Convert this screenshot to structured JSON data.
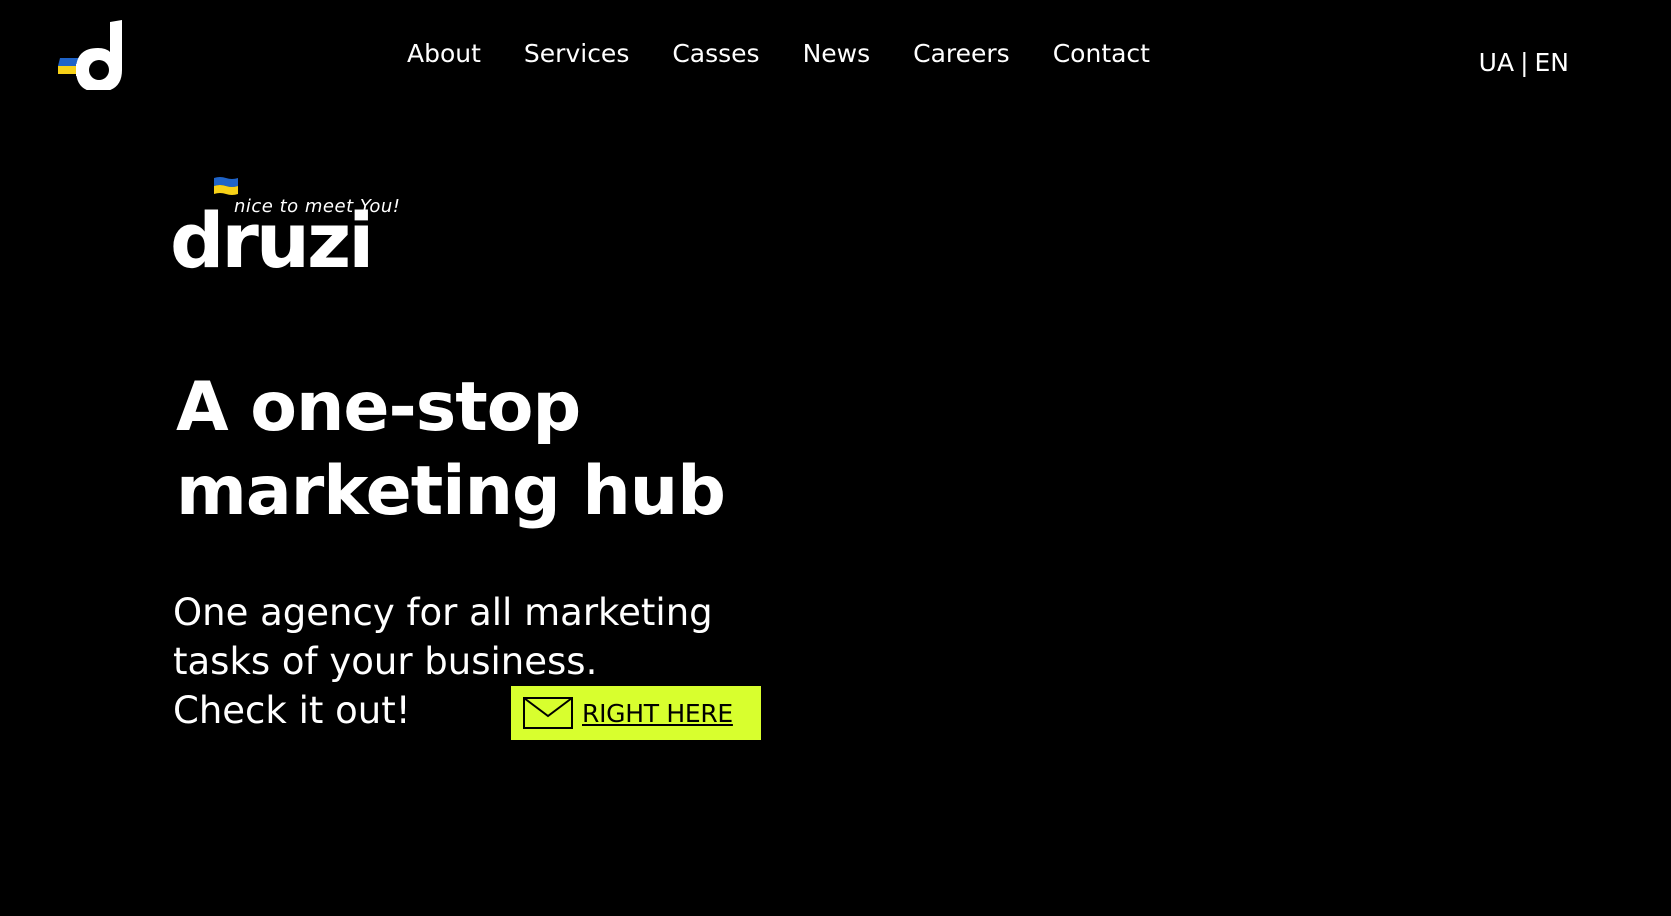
{
  "header": {
    "logo_icon": "druzi-d-logo-icon",
    "nav": [
      {
        "label": "About"
      },
      {
        "label": "Services"
      },
      {
        "label": "Casses"
      },
      {
        "label": "News"
      },
      {
        "label": "Careers"
      },
      {
        "label": "Contact"
      }
    ],
    "lang": {
      "ua": "UA",
      "separator": "|",
      "en": "EN"
    }
  },
  "brand": {
    "tagline": "nice to meet You!",
    "wordmark": "druzi",
    "flag_icon": "ukraine-flag-icon"
  },
  "hero": {
    "title_line1": "A one-stop",
    "title_line2": "marketing hub",
    "sub_line1": "One agency for all marketing",
    "sub_line2": "tasks of your business.",
    "sub_line3": "Check it out!",
    "cta_label": "RIGHT HERE",
    "cta_icon": "envelope-icon"
  },
  "colors": {
    "background": "#000000",
    "text": "#ffffff",
    "accent": "#d8ff2e",
    "flag_blue": "#1f63c7",
    "flag_yellow": "#f7d117"
  }
}
